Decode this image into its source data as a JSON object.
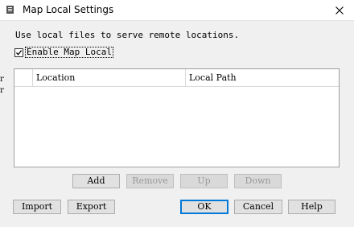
{
  "window": {
    "title": "Map Local Settings"
  },
  "description": "Use local files to serve remote locations.",
  "enable_map_local": {
    "label": "Enable Map Local",
    "checked": true
  },
  "table": {
    "columns": [
      "Location",
      "Local Path"
    ],
    "rows": []
  },
  "table_buttons": {
    "add": "Add",
    "remove": "Remove",
    "up": "Up",
    "down": "Down"
  },
  "footer_buttons": {
    "import": "Import",
    "export": "Export",
    "ok": "OK",
    "cancel": "Cancel",
    "help": "Help"
  }
}
